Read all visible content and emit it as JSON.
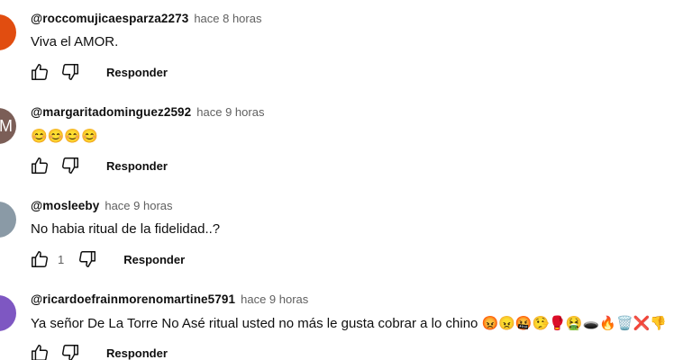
{
  "comments": [
    {
      "author": "@roccomujicaesparza2273",
      "time": "hace 8 horas",
      "text": "Viva el AMOR.",
      "likes": "",
      "reply_label": "Responder",
      "avatar_letter": "",
      "avatar_color": "#e14d10"
    },
    {
      "author": "@margaritadominguez2592",
      "time": "hace 9 horas",
      "text": "😊😊😊😊",
      "likes": "",
      "reply_label": "Responder",
      "avatar_letter": "M",
      "avatar_color": "#7b5e57"
    },
    {
      "author": "@mosleeby",
      "time": "hace 9 horas",
      "text": "No habia ritual de la fidelidad..?",
      "likes": "1",
      "reply_label": "Responder",
      "avatar_letter": "",
      "avatar_color": "#8a9aa6"
    },
    {
      "author": "@ricardoefrainmorenomartine5791",
      "time": "hace 9 horas",
      "text": "Ya señor De La Torre No Asé ritual usted no más le gusta cobrar a lo chino 😡😠🤬🤥🥊🤮🕳️🔥🗑️❌👎",
      "likes": "",
      "reply_label": "Responder",
      "avatar_letter": "",
      "avatar_color": "#7e57c2"
    }
  ],
  "icons": {
    "like": "thumbs-up-icon",
    "dislike": "thumbs-down-icon"
  }
}
